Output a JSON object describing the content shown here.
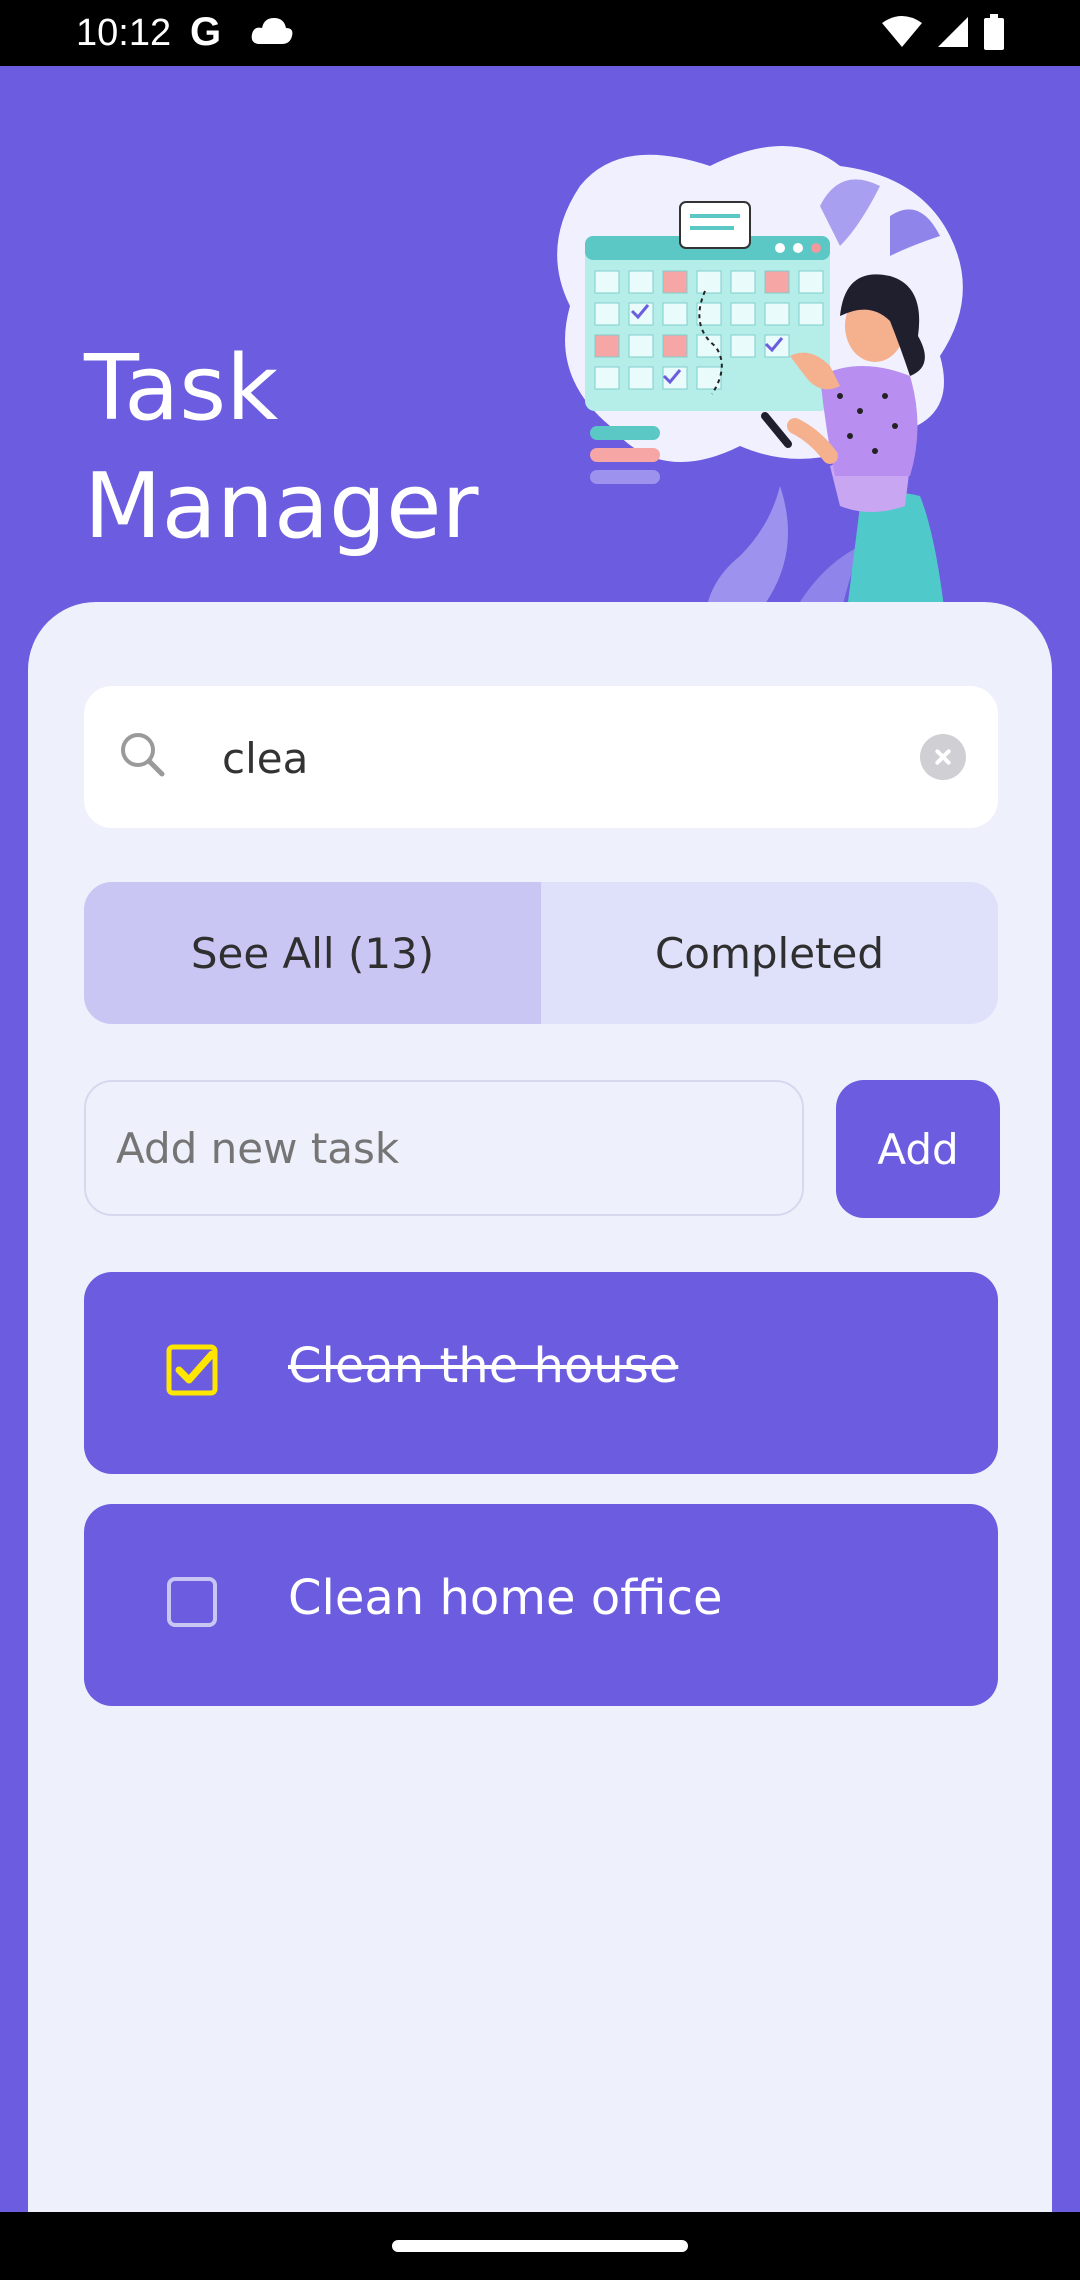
{
  "status_bar": {
    "time": "10:12",
    "g_label": "G",
    "icons": [
      "cloud-icon",
      "wifi-icon",
      "signal-icon",
      "battery-icon"
    ]
  },
  "header": {
    "title_line1": "Task",
    "title_line2": "Manager",
    "illustration": "woman-with-calendar-board-illustration"
  },
  "search": {
    "value": "clea",
    "icon": "search-icon",
    "clear_icon": "clear-icon"
  },
  "tabs": [
    {
      "label": "See All (13)",
      "active": true
    },
    {
      "label": "Completed",
      "active": false
    }
  ],
  "add_task": {
    "placeholder": "Add new task",
    "button_label": "Add"
  },
  "tasks": [
    {
      "label": "Clean the house",
      "completed": true
    },
    {
      "label": "Clean home office",
      "completed": false
    }
  ],
  "colors": {
    "primary": "#6b5ce0",
    "panel_bg": "#eef0fb",
    "tab_active": "#c9c6f4",
    "tab_inactive": "#dfe0fa",
    "check_yellow": "#ffe600"
  }
}
